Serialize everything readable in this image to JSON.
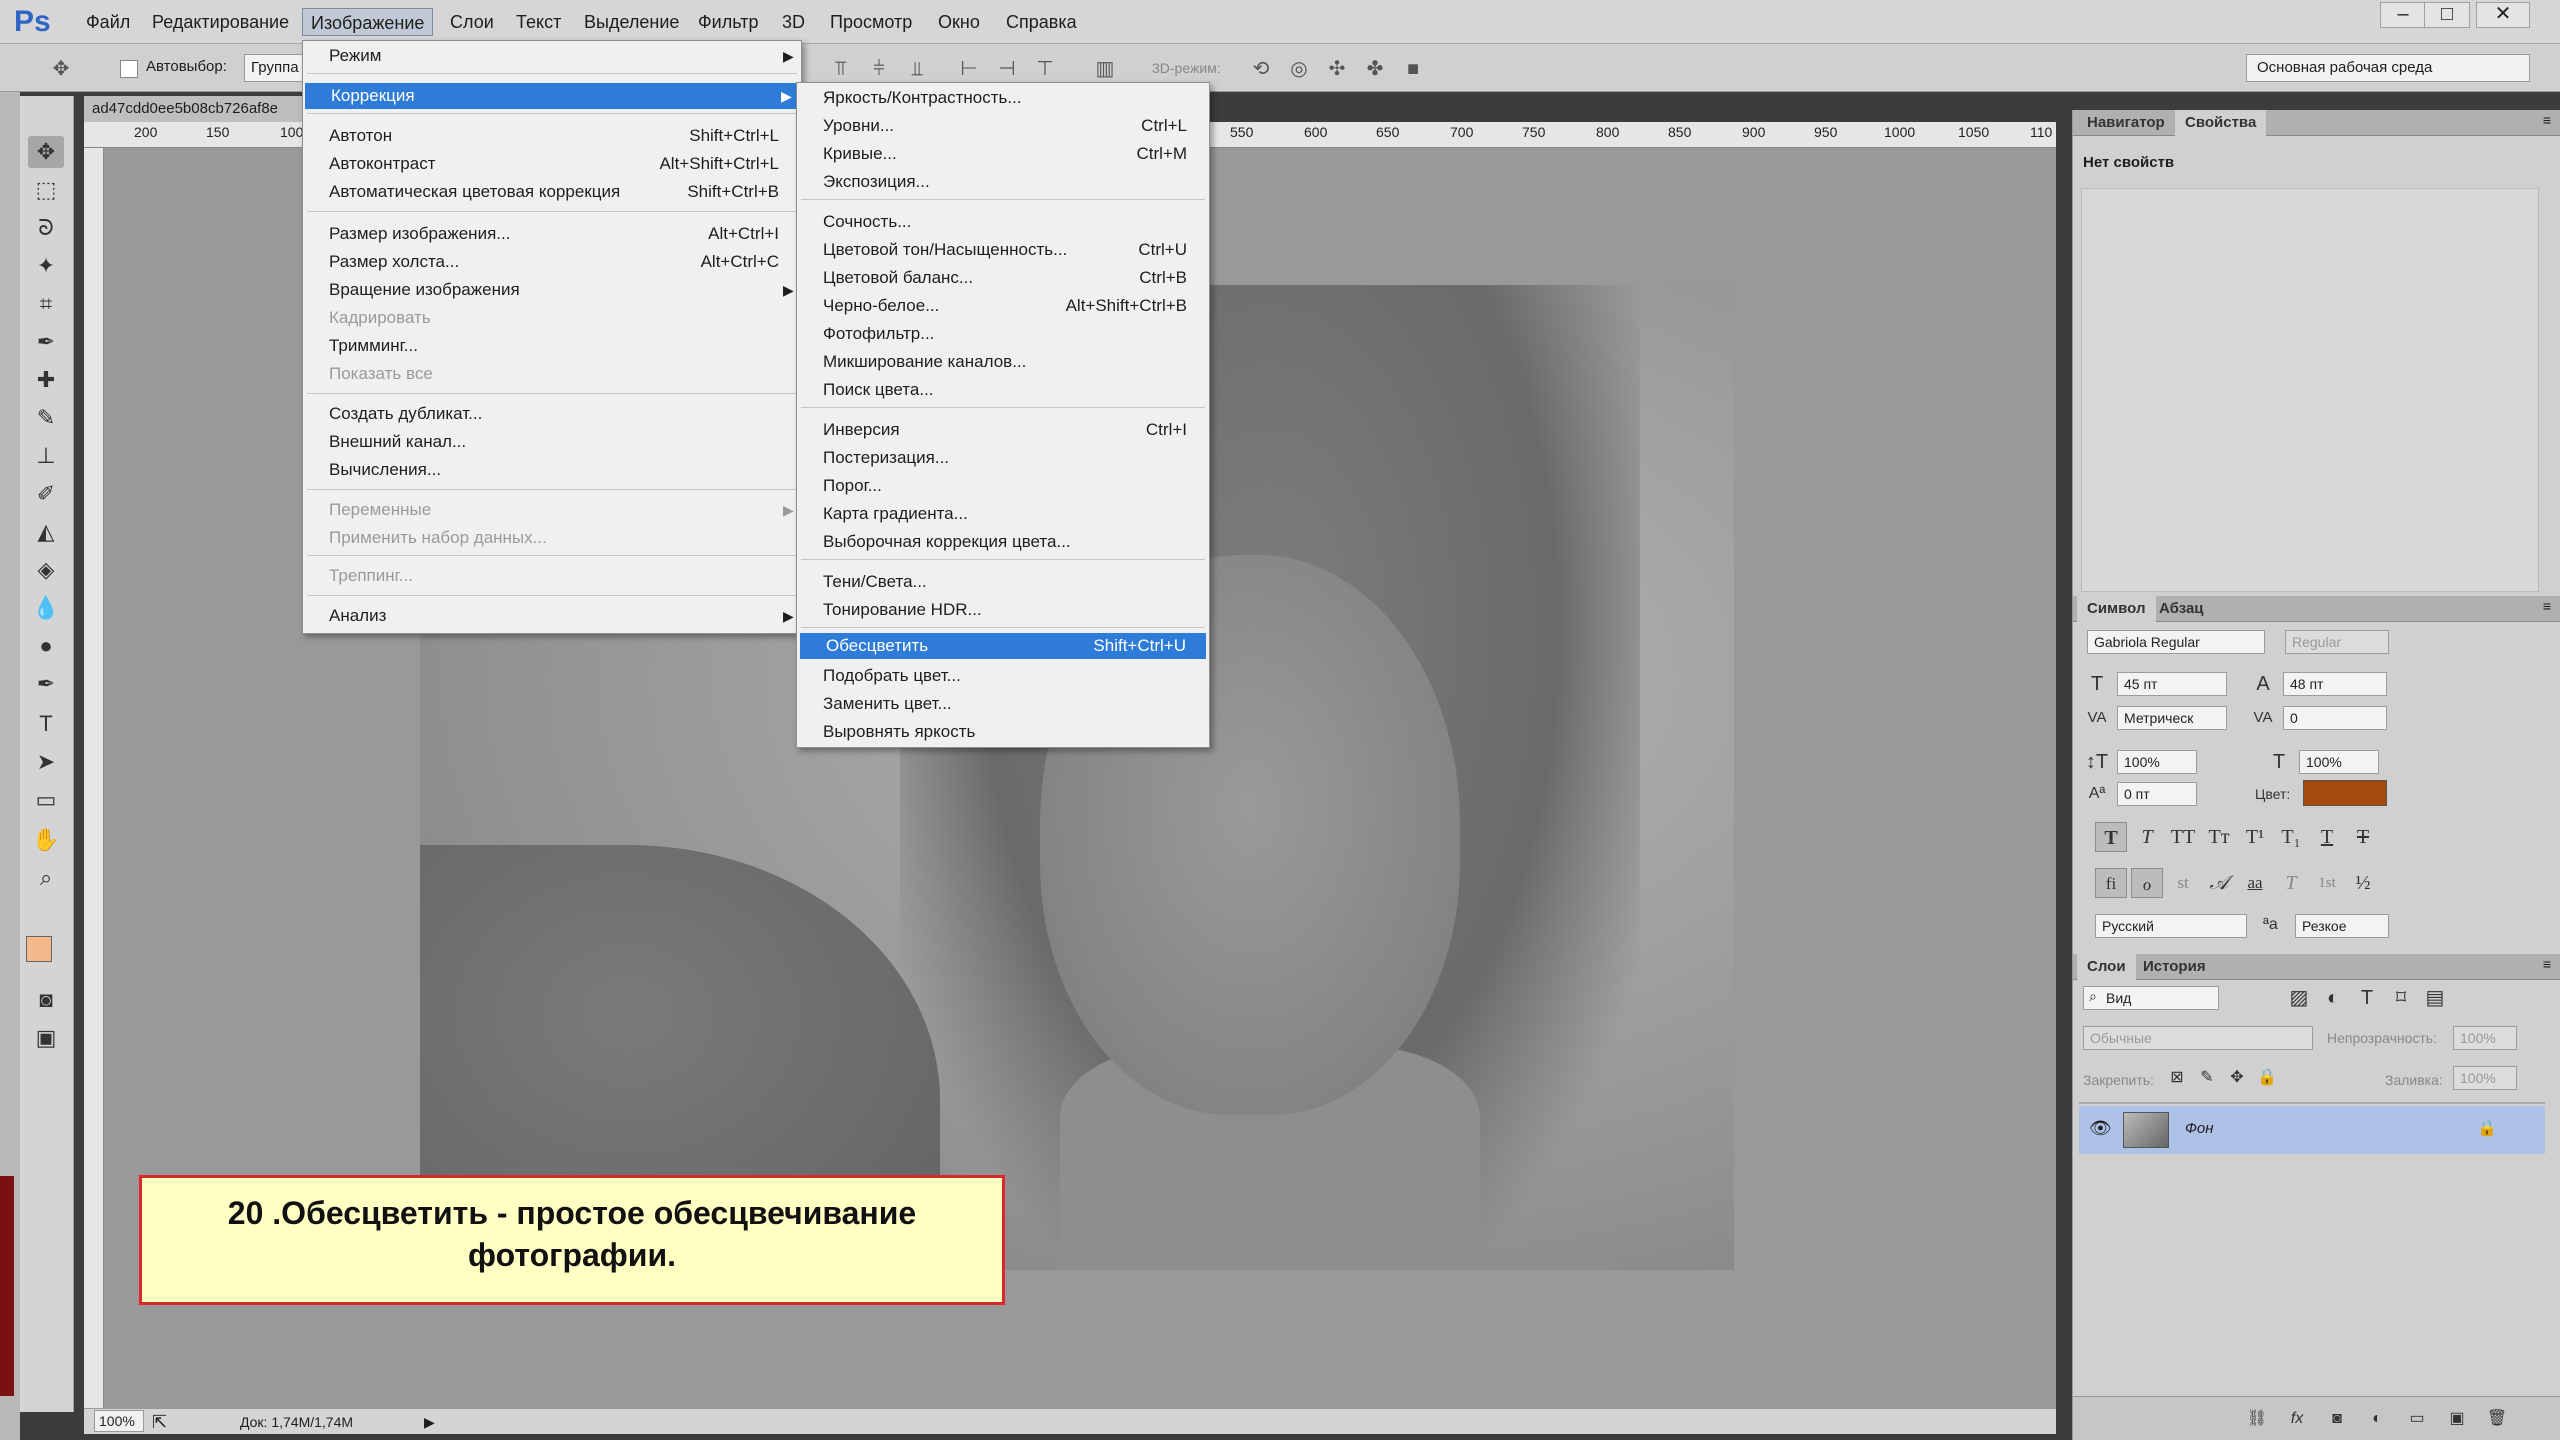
{
  "app": {
    "logo": "Ps",
    "menu": [
      "Файл",
      "Редактирование",
      "Изображение",
      "Слои",
      "Текст",
      "Выделение",
      "Фильтр",
      "3D",
      "Просмотр",
      "Окно",
      "Справка"
    ],
    "window_buttons": [
      "–",
      "□",
      "✕"
    ]
  },
  "options": {
    "autoselect_label": "Автовыбор:",
    "group_label": "Группа",
    "mode_3d_label": "3D-режим:",
    "workspace": "Основная рабочая среда"
  },
  "document": {
    "tab_title": "ad47cdd0ee5b08cb726af8e",
    "ruler_numbers": [
      "200",
      "150",
      "100",
      "550",
      "600",
      "650",
      "700",
      "750",
      "800",
      "850",
      "900",
      "950",
      "1000",
      "1050",
      "110"
    ],
    "zoom": "100%",
    "doc_info": "Док: 1,74M/1,74M"
  },
  "image_menu": {
    "items": [
      {
        "label": "Режим",
        "shortcut": "",
        "submenu": true
      },
      {
        "label": "Коррекция",
        "shortcut": "",
        "submenu": true
      },
      {
        "label": "Автотон",
        "shortcut": "Shift+Ctrl+L"
      },
      {
        "label": "Автоконтраст",
        "shortcut": "Alt+Shift+Ctrl+L"
      },
      {
        "label": "Автоматическая цветовая коррекция",
        "shortcut": "Shift+Ctrl+B"
      },
      {
        "label": "Размер изображения...",
        "shortcut": "Alt+Ctrl+I"
      },
      {
        "label": "Размер холста...",
        "shortcut": "Alt+Ctrl+C"
      },
      {
        "label": "Вращение изображения",
        "shortcut": "",
        "submenu": true
      },
      {
        "label": "Кадрировать",
        "shortcut": ""
      },
      {
        "label": "Тримминг...",
        "shortcut": ""
      },
      {
        "label": "Показать все",
        "shortcut": ""
      },
      {
        "label": "Создать дубликат...",
        "shortcut": ""
      },
      {
        "label": "Внешний канал...",
        "shortcut": ""
      },
      {
        "label": "Вычисления...",
        "shortcut": ""
      },
      {
        "label": "Переменные",
        "shortcut": "",
        "submenu": true
      },
      {
        "label": "Применить набор данных...",
        "shortcut": ""
      },
      {
        "label": "Треппинг...",
        "shortcut": ""
      },
      {
        "label": "Анализ",
        "shortcut": "",
        "submenu": true
      }
    ]
  },
  "correction_menu": {
    "items": [
      {
        "label": "Яркость/Контрастность...",
        "shortcut": ""
      },
      {
        "label": "Уровни...",
        "shortcut": "Ctrl+L"
      },
      {
        "label": "Кривые...",
        "shortcut": "Ctrl+M"
      },
      {
        "label": "Экспозиция...",
        "shortcut": ""
      },
      {
        "label": "Сочность...",
        "shortcut": ""
      },
      {
        "label": "Цветовой тон/Насыщенность...",
        "shortcut": "Ctrl+U"
      },
      {
        "label": "Цветовой баланс...",
        "shortcut": "Ctrl+B"
      },
      {
        "label": "Черно-белое...",
        "shortcut": "Alt+Shift+Ctrl+B"
      },
      {
        "label": "Фотофильтр...",
        "shortcut": ""
      },
      {
        "label": "Микширование каналов...",
        "shortcut": ""
      },
      {
        "label": "Поиск цвета...",
        "shortcut": ""
      },
      {
        "label": "Инверсия",
        "shortcut": "Ctrl+I"
      },
      {
        "label": "Постеризация...",
        "shortcut": ""
      },
      {
        "label": "Порог...",
        "shortcut": ""
      },
      {
        "label": "Карта градиента...",
        "shortcut": ""
      },
      {
        "label": "Выборочная коррекция цвета...",
        "shortcut": ""
      },
      {
        "label": "Тени/Света...",
        "shortcut": ""
      },
      {
        "label": "Тонирование HDR...",
        "shortcut": ""
      },
      {
        "label": "Обесцветить",
        "shortcut": "Shift+Ctrl+U"
      },
      {
        "label": "Подобрать цвет...",
        "shortcut": ""
      },
      {
        "label": "Заменить цвет...",
        "shortcut": ""
      },
      {
        "label": "Выровнять яркость",
        "shortcut": ""
      }
    ]
  },
  "caption": {
    "line1": "20 .Обесцветить - простое обесцвечивание",
    "line2": "фотографии."
  },
  "properties_panel": {
    "tabs": [
      "Навигатор",
      "Свойства"
    ],
    "empty_text": "Нет свойств"
  },
  "character_panel": {
    "tabs": [
      "Символ",
      "Абзац"
    ],
    "font_family": "Gabriola Regular",
    "font_style": "Regular",
    "font_size": "45 пт",
    "leading": "48 пт",
    "kerning": "Метрическ",
    "tracking": "0",
    "vertical_scale": "100%",
    "horizontal_scale": "100%",
    "baseline_shift": "0 пт",
    "color_label": "Цвет:",
    "text_color": "#a5490c",
    "language": "Русский",
    "aa_label": "ªa",
    "antialias": "Резкое",
    "style_glyphs": [
      "T",
      "T",
      "TT",
      "Tт",
      "T¹",
      "T₁",
      "T",
      "T"
    ],
    "opentype_glyphs": [
      "fi",
      "ℴ",
      "st",
      "𝒜",
      "aa",
      "T",
      "1st",
      "½"
    ]
  },
  "layers_panel": {
    "tabs": [
      "Слои",
      "История"
    ],
    "filter_placeholder": "Вид",
    "blend_mode": "Обычные",
    "opacity_label": "Непрозрачность:",
    "opacity": "100%",
    "lock_label": "Закрепить:",
    "fill_label": "Заливка:",
    "fill": "100%",
    "layers": [
      {
        "name": "Фон",
        "locked": true,
        "visible": true
      }
    ]
  },
  "colors": {
    "accent": "#2f7bd8",
    "caption_border": "#d9272e",
    "caption_bg": "#ffffc4",
    "foreground_swatch": "#f4b98a"
  }
}
